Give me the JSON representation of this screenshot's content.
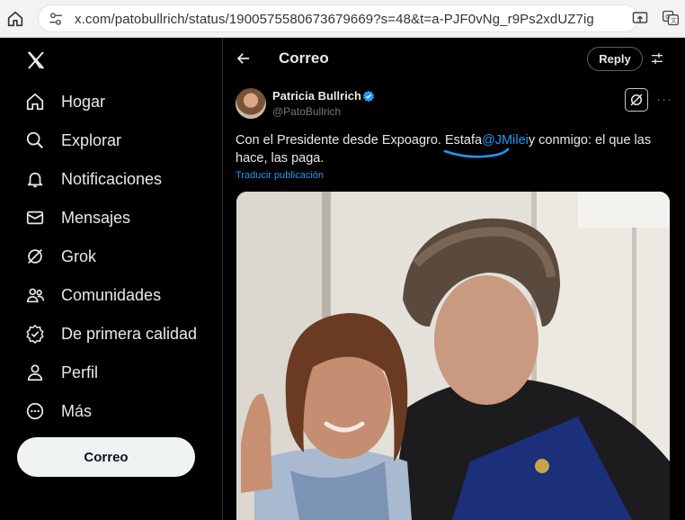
{
  "browser": {
    "url": "x.com/patobullrich/status/1900575580673679669?s=48&t=a-PJF0vNg_r9Ps2xdUZ7ig",
    "icons": [
      "home-icon",
      "site-settings-icon",
      "cast-icon",
      "translate-icon"
    ]
  },
  "nav": {
    "items": [
      {
        "label": "Hogar",
        "icon": "home-icon"
      },
      {
        "label": "Explorar",
        "icon": "search-icon"
      },
      {
        "label": "Notificaciones",
        "icon": "bell-icon"
      },
      {
        "label": "Mensajes",
        "icon": "mail-icon"
      },
      {
        "label": "Grok",
        "icon": "grok-icon"
      },
      {
        "label": "Comunidades",
        "icon": "communities-icon"
      },
      {
        "label": "De primera calidad",
        "icon": "premium-icon"
      },
      {
        "label": "Perfil",
        "icon": "person-icon"
      },
      {
        "label": "Más",
        "icon": "more-circle-icon"
      }
    ],
    "post_button": "Correo"
  },
  "header": {
    "title": "Correo",
    "reply_button": "Reply"
  },
  "tweet": {
    "author_name": "Patricia Bullrich",
    "author_handle": "@PatoBullrich",
    "text_before": "Con el Presidente desde Expoagro. Estafa",
    "mention": "@JMilei",
    "text_after": "y conmigo: el que las hace, las paga.",
    "translate_link": "Traducir publicación"
  },
  "colors": {
    "accent": "#1d9bf0",
    "background": "#000000",
    "text": "#e7e9ea",
    "secondary_text": "#71767b"
  }
}
